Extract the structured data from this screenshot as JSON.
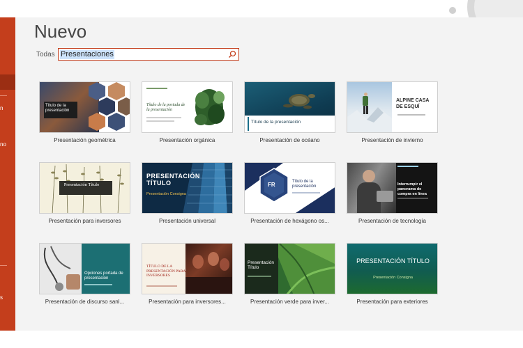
{
  "page_title": "Nuevo",
  "search": {
    "scope_label": "Todas",
    "query": "Presentaciones"
  },
  "sidebar": {
    "fragments": [
      "n",
      "no",
      "s"
    ]
  },
  "templates": [
    {
      "label": "Presentación geométrica",
      "thumb_text": "Título de la presentación"
    },
    {
      "label": "Presentación orgánica",
      "thumb_text": "Título de la portada de la presentación"
    },
    {
      "label": "Presentación de océano",
      "thumb_text": "Título de la presentación"
    },
    {
      "label": "Presentación de invierno",
      "thumb_text": "ALPINE CASA DE ESQUÍ"
    },
    {
      "label": "Presentación para inversores",
      "thumb_text": "Presentación Título"
    },
    {
      "label": "Presentación universal",
      "thumb_text": "PRESENTACIÓN TÍTULO",
      "thumb_sub": "Presentación Consigna"
    },
    {
      "label": "Presentación de hexágono os...",
      "thumb_text": "Título de la presentación",
      "thumb_badge": "FR"
    },
    {
      "label": "Presentación de tecnología",
      "thumb_text": "Interrumpir el panorama de compra en línea"
    },
    {
      "label": "Presentación de discurso sanl...",
      "thumb_text": "Opciones portada de presentación"
    },
    {
      "label": "Presentación para inversores...",
      "thumb_text": "TÍTULO DE LA PRESENTACIÓN PARA INVERSORES"
    },
    {
      "label": "Presentación verde para inver...",
      "thumb_text": "Presentación Título"
    },
    {
      "label": "Presentación para exteriores",
      "thumb_text": "PRESENTACIÓN TÍTULO",
      "thumb_sub": "Presentación Consigna"
    }
  ],
  "colors": {
    "accent": "#c43e1c",
    "background": "#f3f3f3"
  }
}
